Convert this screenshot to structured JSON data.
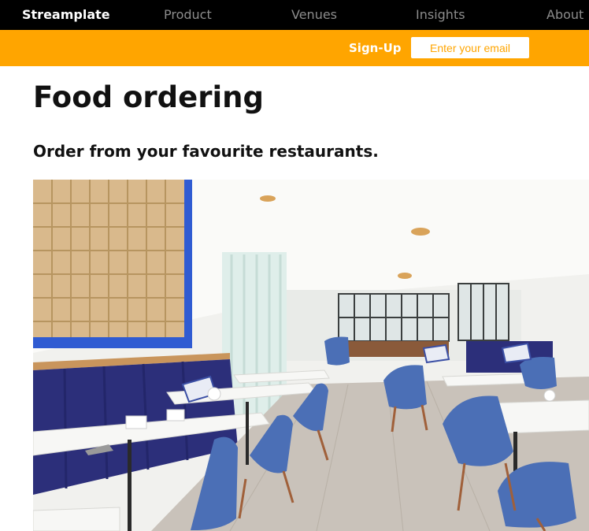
{
  "nav": {
    "brand": "Streamplate",
    "links": [
      "Product",
      "Venues",
      "Insights",
      "About"
    ]
  },
  "signup": {
    "label": "Sign-Up",
    "email_placeholder": "Enter your email"
  },
  "main": {
    "title": "Food ordering",
    "subtitle": "Order from your favourite restaurants."
  },
  "colors": {
    "nav_background": "#000000",
    "signup_bar": "#ffa500",
    "accent_text": "#ffa500"
  }
}
